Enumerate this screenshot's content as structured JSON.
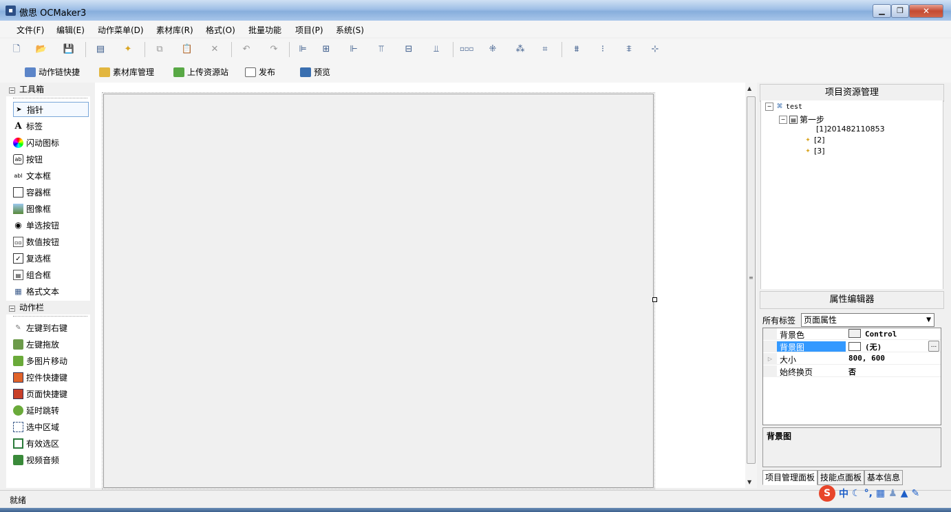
{
  "window": {
    "title": "傲思 OCMaker3",
    "app_icon": "app-icon",
    "min": "min-icon",
    "max": "max-icon",
    "close": "close-icon"
  },
  "menu": [
    "文件(F)",
    "编辑(E)",
    "动作菜单(D)",
    "素材库(R)",
    "格式(O)",
    "批量功能",
    "项目(P)",
    "系统(S)"
  ],
  "toolbar2": {
    "action_chain": "动作链快捷",
    "library": "素材库管理",
    "upload": "上传资源站",
    "publish": "发布",
    "preview": "预览"
  },
  "toolbox": {
    "header": "工具箱",
    "items": [
      "指针",
      "标签",
      "闪动图标",
      "按钮",
      "文本框",
      "容器框",
      "图像框",
      "单选按钮",
      "数值按钮",
      "复选框",
      "组合框",
      "格式文本"
    ]
  },
  "actionbar": {
    "header": "动作栏",
    "items": [
      "左键到右键",
      "左键拖放",
      "多图片移动",
      "控件快捷键",
      "页面快捷键",
      "延时跳转",
      "选中区域",
      "有效选区",
      "视频音频"
    ]
  },
  "project": {
    "header": "项目资源管理",
    "root": "test",
    "step": "第一步",
    "children": [
      "[1]201482110853",
      "[2]",
      "[3]"
    ]
  },
  "props": {
    "header": "属性编辑器",
    "filter_label": "所有标签",
    "filter_value": "页面属性",
    "rows": [
      {
        "key": "背景色",
        "value": "Control"
      },
      {
        "key": "背景图",
        "value": "(无)"
      },
      {
        "key": "大小",
        "value": "800, 600"
      },
      {
        "key": "始终换页",
        "value": "否"
      }
    ],
    "ellipsis": "...",
    "desc_title": "背景图"
  },
  "tabs": [
    "项目管理面板",
    "技能点面板",
    "基本信息"
  ],
  "status": "就绪",
  "ime": [
    "中",
    "·",
    "°,",
    "▦",
    "♟",
    "👕",
    "🔧"
  ],
  "colors": {
    "titlebar": "#9fbfe6",
    "selection": "#3399ff",
    "close": "#c44a32"
  }
}
